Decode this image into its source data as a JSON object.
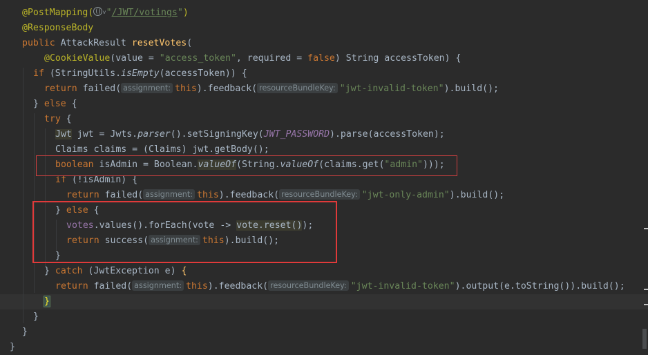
{
  "code": {
    "l1_ann": "@PostMapping(",
    "l1_str_open": "\"",
    "l1_url": "/JWT/votings",
    "l1_str_close": "\"",
    "l1_close": ")",
    "l2": "@ResponseBody",
    "l3_kw": "public",
    "l3_type": " AttackResult ",
    "l3_fn": "resetVotes",
    "l3_paren": "(",
    "l4_ann": "@CookieValue",
    "l4_a": "(value = ",
    "l4_str": "\"access_token\"",
    "l4_b": ", required = ",
    "l4_false": "false",
    "l4_c": ") String accessToken) {",
    "l5_kw": "if",
    "l5_a": " (StringUtils.",
    "l5_it": "isEmpty",
    "l5_b": "(accessToken)) {",
    "l6_kw": "return",
    "l6_a": " failed(",
    "l6_hint": "assignment:",
    "l6_this": "this",
    "l6_b": ").feedback(",
    "l6_hint2": "resourceBundleKey:",
    "l6_str": "\"jwt-invalid-token\"",
    "l6_c": ").build();",
    "l7_a": "} ",
    "l7_kw": "else",
    "l7_b": " {",
    "l8_kw": "try",
    "l8_b": " {",
    "l9_jwt": "Jwt",
    "l9_a": " jwt = Jwts.",
    "l9_it": "parser",
    "l9_b": "().setSigningKey(",
    "l9_const": "JWT_PASSWORD",
    "l9_c": ").parse(accessToken);",
    "l10": "Claims claims = (Claims) jwt.getBody();",
    "l11_kw": "boolean",
    "l11_a": " isAdmin = Boolean.",
    "l11_it": "valueOf",
    "l11_b": "(String.",
    "l11_it2": "valueOf",
    "l11_c": "(claims.get(",
    "l11_str": "\"admin\"",
    "l11_d": ")));",
    "l12_kw": "if",
    "l12_a": " (!isAdmin) {",
    "l13_kw": "return",
    "l13_a": " failed(",
    "l13_hint": "assignment:",
    "l13_this": "this",
    "l13_b": ").feedback(",
    "l13_hint2": "resourceBundleKey:",
    "l13_str": "\"jwt-only-admin\"",
    "l13_c": ").build();",
    "l14_a": "} ",
    "l14_kw": "else",
    "l14_b": " {",
    "l15_field": "votes",
    "l15_a": ".values().forEach(vote -> ",
    "l15_hl": "vote.reset()",
    "l15_b": ");",
    "l16_kw": "return",
    "l16_a": " success(",
    "l16_hint": "assignment:",
    "l16_this": "this",
    "l16_b": ").build();",
    "l17": "}",
    "l18_a": "} ",
    "l18_kw": "catch",
    "l18_b": " (JwtException e) ",
    "l18_brace": "{",
    "l19_kw": "return",
    "l19_a": " failed(",
    "l19_hint": "assignment:",
    "l19_this": "this",
    "l19_b": ").feedback(",
    "l19_hint2": "resourceBundleKey:",
    "l19_str": "\"jwt-invalid-token\"",
    "l19_c": ").output(e.toString()).build();",
    "l20": "}",
    "l21": "}",
    "l22": "}",
    "l23": "}"
  },
  "colors": {
    "background": "#2b2b2b",
    "keyword": "#cc7832",
    "string": "#6a8759",
    "annotation": "#bbb529",
    "method": "#ffc66d",
    "field": "#9876aa",
    "highlight_box": "#e03a3a"
  },
  "icons": {
    "globe": "globe-icon",
    "chevron": "chevron-down-icon"
  }
}
